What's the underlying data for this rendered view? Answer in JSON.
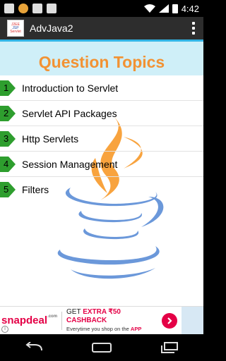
{
  "status_bar": {
    "time": "4:42"
  },
  "action_bar": {
    "app_title": "AdvJava2",
    "app_icon_lines": [
      "J2EE",
      "JSP",
      "Servlet"
    ]
  },
  "page": {
    "title": "Question Topics",
    "topics": [
      {
        "num": "1",
        "label": "Introduction to Servlet"
      },
      {
        "num": "2",
        "label": "Servlet API Packages"
      },
      {
        "num": "3",
        "label": "Http Servlets"
      },
      {
        "num": "4",
        "label": "Session Management"
      },
      {
        "num": "5",
        "label": "Filters"
      }
    ]
  },
  "ad": {
    "brand": "snapdeal",
    "brand_suffix": ".com",
    "line1_prefix": "GET ",
    "line1_highlight": "EXTRA ₹50 CASHBACK",
    "line2_prefix": "Everytime you shop on the ",
    "line2_highlight": "APP",
    "info": "i"
  },
  "colors": {
    "title": "#f29233",
    "header_band": "#cfeff8",
    "accent_line": "#33b5e5",
    "topic_arrow": "#2e9e2e",
    "ad_brand": "#e40046"
  },
  "icons": [
    "whatsapp-icon",
    "music-icon",
    "notification-off-icon",
    "image-icon",
    "wifi-icon",
    "signal-icon",
    "battery-icon",
    "overflow-menu-icon",
    "back-icon",
    "home-icon",
    "recents-icon",
    "java-logo-icon"
  ]
}
